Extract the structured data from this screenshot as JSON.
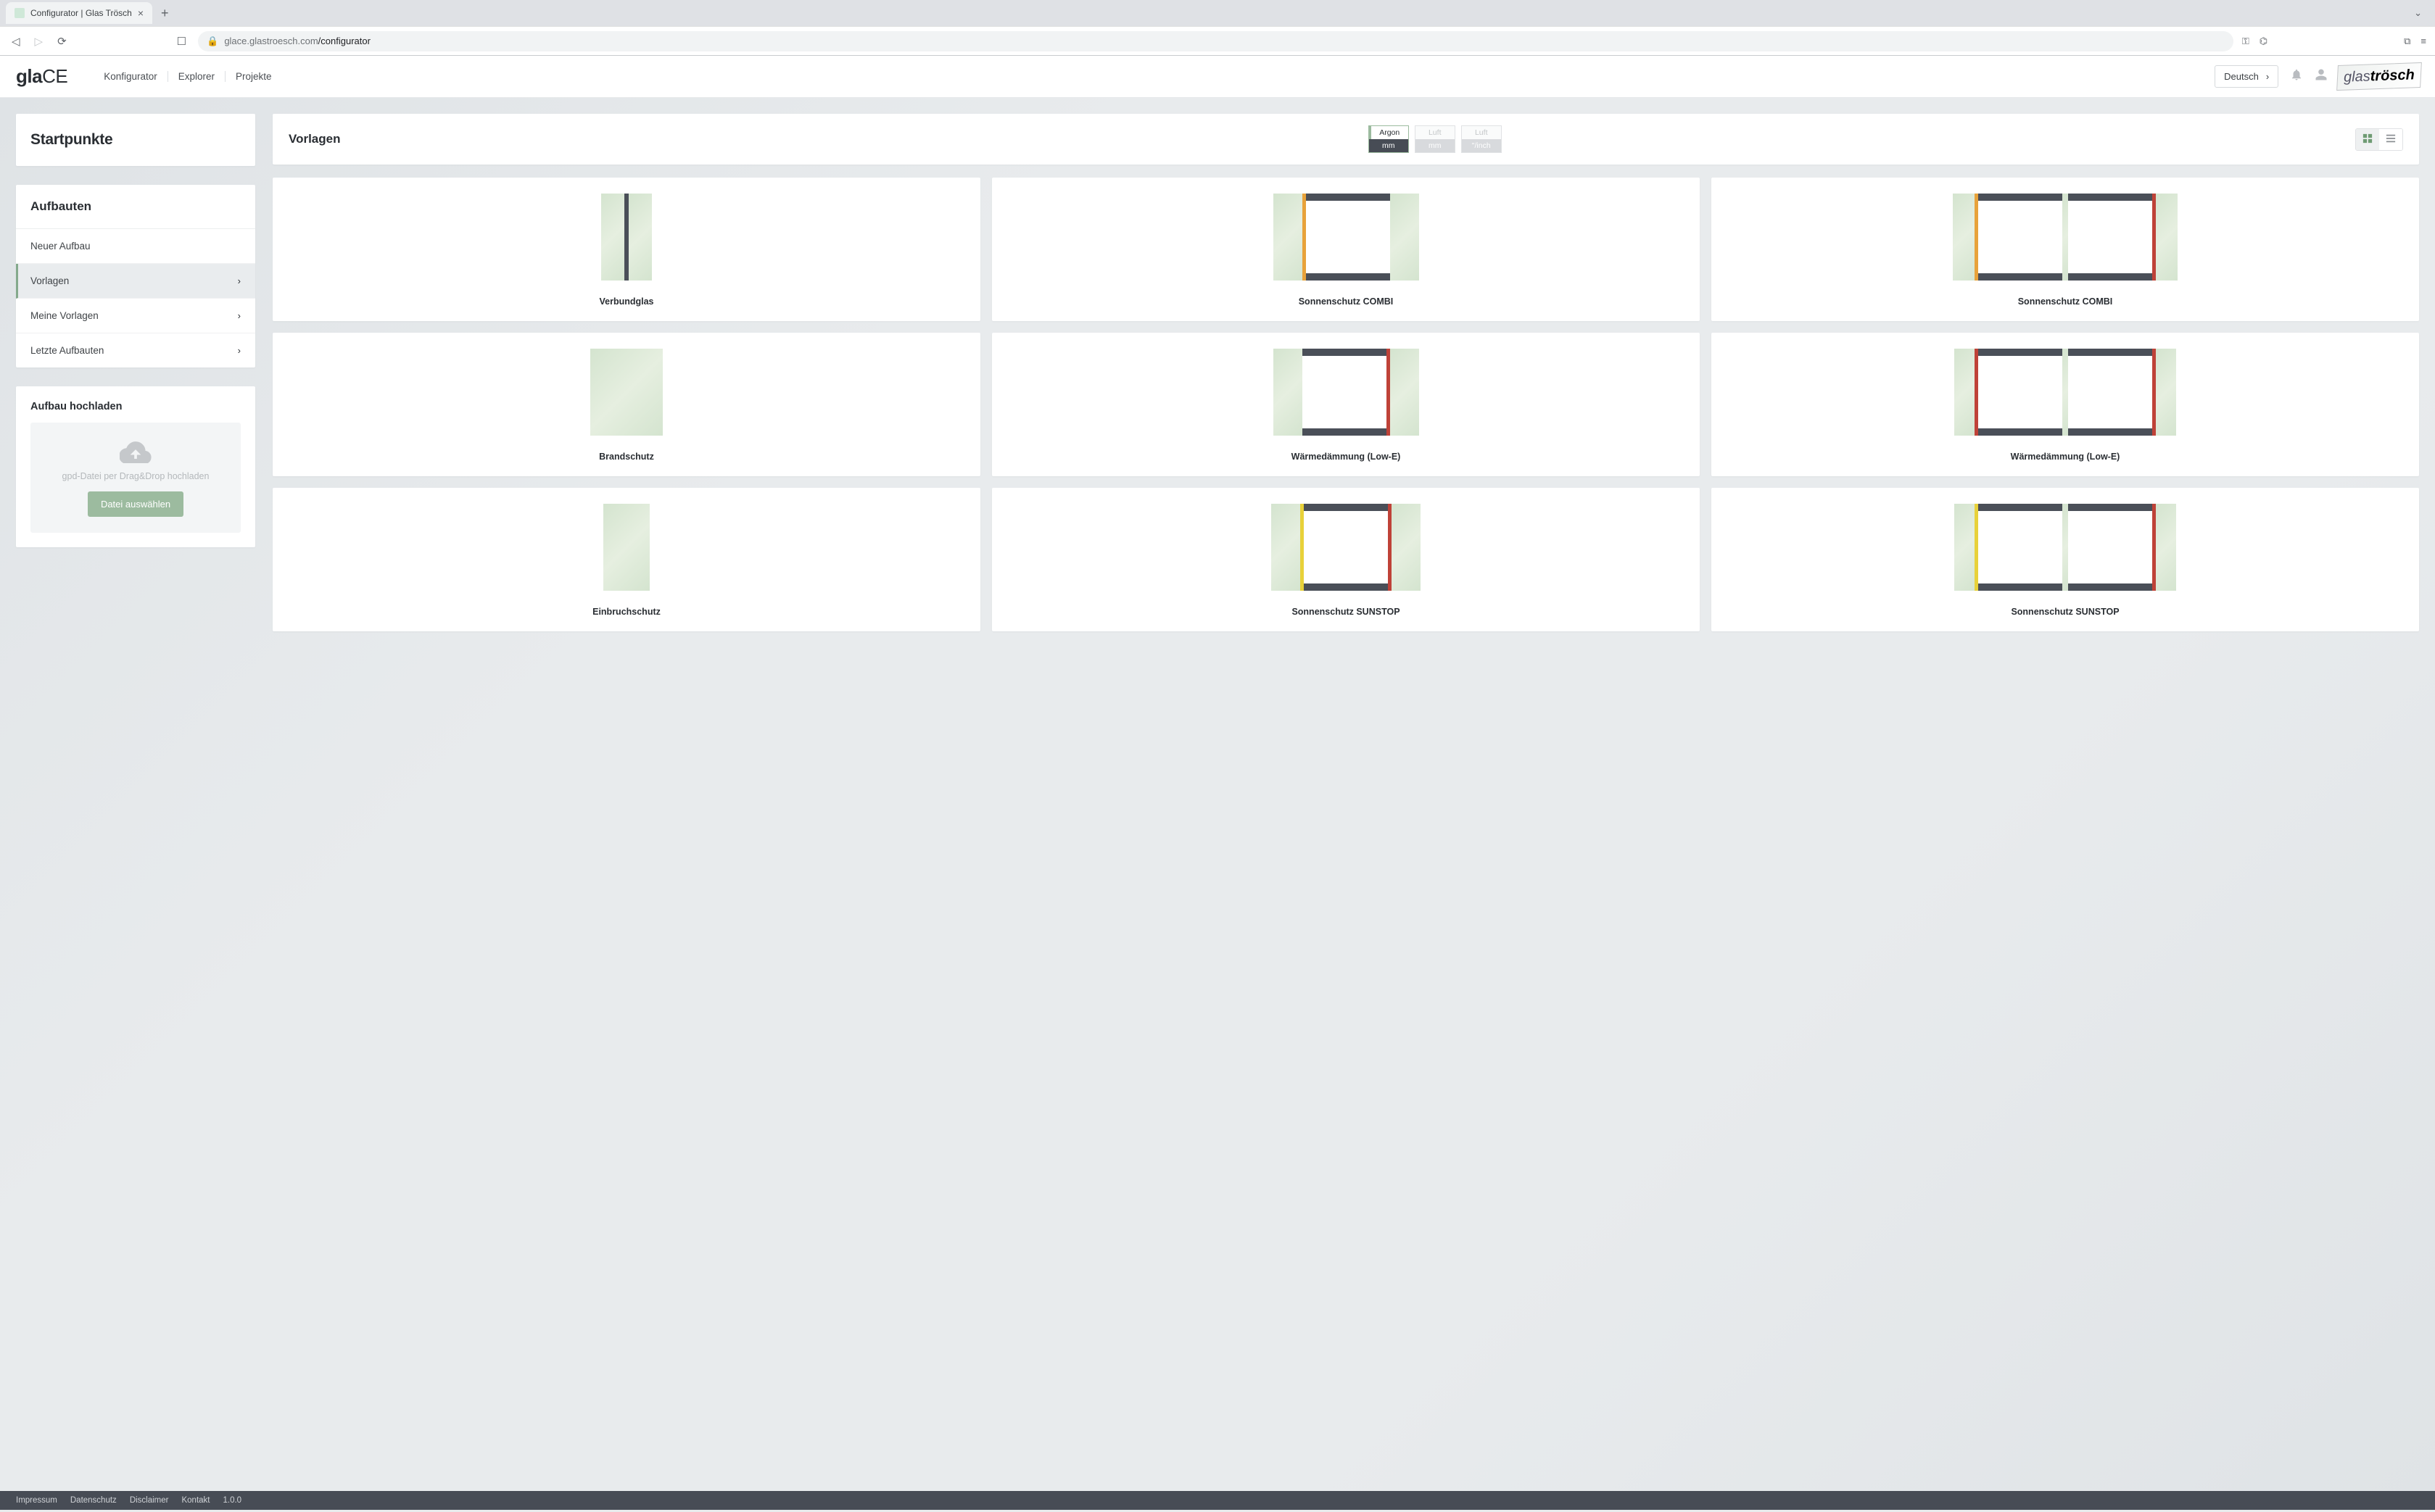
{
  "browser": {
    "tab_title": "Configurator | Glas Trösch",
    "url_host": "glace.glastroesch.com",
    "url_path": "/configurator"
  },
  "header": {
    "logo_bold": "gla",
    "logo_thin": "CE",
    "nav": [
      "Konfigurator",
      "Explorer",
      "Projekte"
    ],
    "language": "Deutsch",
    "company_a": "glas",
    "company_b": "trösch"
  },
  "sidebar": {
    "start_title": "Startpunkte",
    "menu_title": "Aufbauten",
    "items": [
      {
        "label": "Neuer Aufbau",
        "chevron": false,
        "active": false
      },
      {
        "label": "Vorlagen",
        "chevron": true,
        "active": true
      },
      {
        "label": "Meine Vorlagen",
        "chevron": true,
        "active": false
      },
      {
        "label": "Letzte Aufbauten",
        "chevron": true,
        "active": false
      }
    ],
    "upload": {
      "title": "Aufbau hochladen",
      "hint": "gpd-Datei per Drag&Drop hochladen",
      "button": "Datei auswählen"
    }
  },
  "main": {
    "title": "Vorlagen",
    "units": [
      {
        "top": "Argon",
        "bot": "mm",
        "active": true
      },
      {
        "top": "Luft",
        "bot": "mm",
        "active": false
      },
      {
        "top": "Luft",
        "bot": "\"/inch",
        "active": false
      }
    ],
    "cards": [
      {
        "title": "Verbundglas"
      },
      {
        "title": "Sonnenschutz COMBI"
      },
      {
        "title": "Sonnenschutz COMBI"
      },
      {
        "title": "Brandschutz"
      },
      {
        "title": "Wärmedämmung (Low-E)"
      },
      {
        "title": "Wärmedämmung (Low-E)"
      },
      {
        "title": "Einbruchschutz"
      },
      {
        "title": "Sonnenschutz SUNSTOP"
      },
      {
        "title": "Sonnenschutz SUNSTOP"
      }
    ]
  },
  "footer": {
    "links": [
      "Impressum",
      "Datenschutz",
      "Disclaimer",
      "Kontakt"
    ],
    "version": "1.0.0"
  }
}
